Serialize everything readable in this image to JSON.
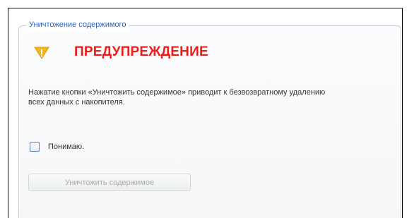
{
  "section": {
    "legend": "Уничтожение содержимого"
  },
  "warning": {
    "icon": "warning-triangle-icon",
    "title": "ПРЕДУПРЕЖДЕНИЕ",
    "text": "Нажатие кнопки «Уничтожить содержимое» приводит к безвозвратному удалению всех данных с накопителя."
  },
  "confirm": {
    "label": "Понимаю.",
    "checked": false
  },
  "actions": {
    "destroy_label": "Уничтожить содержимое",
    "destroy_enabled": false
  },
  "colors": {
    "legend": "#2d63bb",
    "warning_title": "#ef1b1b",
    "icon_fill": "#f5b51d"
  }
}
